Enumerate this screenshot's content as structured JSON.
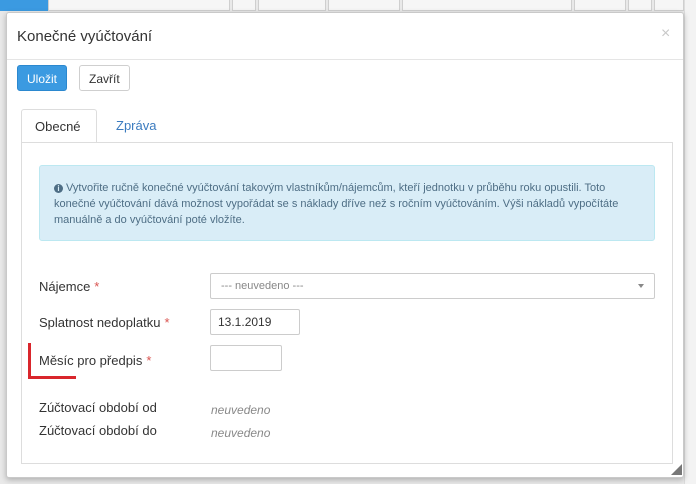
{
  "dialog": {
    "title": "Konečné vyúčtování",
    "close_symbol": "×"
  },
  "toolbar": {
    "save_label": "Uložit",
    "close_label": "Zavřít"
  },
  "tabs": [
    {
      "label": "Obecné",
      "active": true
    },
    {
      "label": "Zpráva",
      "active": false
    }
  ],
  "alert": {
    "icon": "info-circle-icon",
    "text": "Vytvořite ručně konečné vyúčtování takovým vlastníkům/nájemcům, kteří jednotku v průběhu roku opustili. Toto konečné vyúčtování dává možnost vypořádat se s náklady dříve než s ročním vyúčtováním. Výši nákladů vypočítáte manuálně a do vyúčtování poté vložíte."
  },
  "form": {
    "tenant_label": "Nájemce",
    "tenant_value": "--- neuvedeno ---",
    "due_label": "Splatnost nedoplatku",
    "due_value": "13.1.2019",
    "month_label": "Měsíc pro předpis",
    "month_value": "",
    "period_from_label": "Zúčtovací období od",
    "period_from_value": "neuvedeno",
    "period_to_label": "Zúčtovací období do",
    "period_to_value": "neuvedeno",
    "required_mark": "*"
  },
  "colors": {
    "primary": "#3b9ae1",
    "alert_bg": "#d9edf7",
    "required": "#d9534f",
    "annotation": "#d9262c",
    "link": "#3b7bbf"
  }
}
